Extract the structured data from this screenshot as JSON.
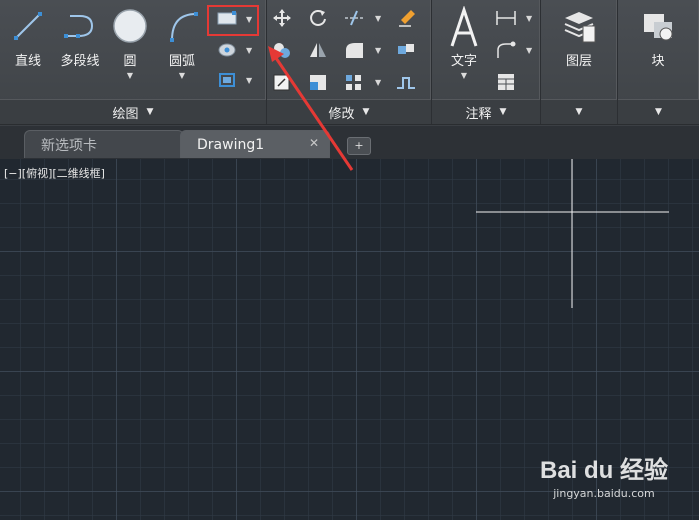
{
  "ribbon": {
    "draw_panel": {
      "title": "绘图",
      "line_label": "直线",
      "polyline_label": "多段线",
      "circle_label": "圆",
      "arc_label": "圆弧"
    },
    "modify_panel": {
      "title": "修改"
    },
    "annotation_panel": {
      "title": "注释",
      "text_label": "文字"
    },
    "layers_panel": {
      "label": "图层"
    },
    "block_panel": {
      "label": "块"
    }
  },
  "tabs": {
    "new_tab_label": "新选项卡",
    "drawing_tab_label": "Drawing1",
    "close_glyph": "✕",
    "add_glyph": "+"
  },
  "canvas": {
    "viewport_label": "[−][俯视][二维线框]"
  },
  "watermark": {
    "logo": "Bai du 经验",
    "url": "jingyan.baidu.com"
  },
  "colors": {
    "highlight": "#e53935",
    "canvas_bg": "#212830",
    "ribbon_bg": "#43474c"
  },
  "icons": [
    "line-icon",
    "polyline-icon",
    "circle-icon",
    "arc-icon",
    "rectangle-icon",
    "hatch-icon",
    "move-icon",
    "rotate-icon",
    "trim-icon",
    "copy-icon",
    "mirror-icon",
    "fillet-icon",
    "scale-icon",
    "array-icon",
    "erase-icon",
    "explode-icon",
    "text-icon",
    "dimension-icon",
    "leader-icon",
    "table-icon",
    "layers-icon",
    "block-icon"
  ]
}
